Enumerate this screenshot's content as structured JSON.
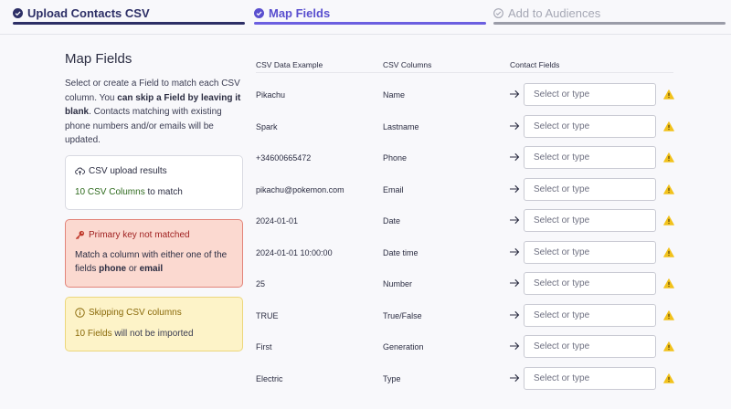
{
  "stepper": {
    "steps": [
      {
        "label": "Upload Contacts CSV",
        "state": "completed",
        "icon": "check-circle-icon"
      },
      {
        "label": "Map Fields",
        "state": "active",
        "icon": "check-circle-icon"
      },
      {
        "label": "Add to Audiences",
        "state": "pending",
        "icon": "check-circle-outline-icon"
      }
    ]
  },
  "left": {
    "title": "Map Fields",
    "desc_part1": "Select or create a Field to match each CSV column. You ",
    "desc_bold": "can skip a Field by leaving it blank",
    "desc_part2": ". Contacts matching with existing phone numbers and/or emails will be updated.",
    "results": {
      "icon": "cloud-upload-icon",
      "title": "CSV upload results",
      "count": "10 CSV Columns",
      "suffix": " to match"
    },
    "primary_key": {
      "icon": "key-icon",
      "title": "Primary key not matched",
      "text1": "Match a column with either one of the fields ",
      "bold1": "phone",
      "text2": " or ",
      "bold2": "email"
    },
    "skipping": {
      "icon": "info-circle-icon",
      "title": "Skipping CSV columns",
      "count": "10 Fields",
      "suffix": " will not be imported"
    }
  },
  "table": {
    "headers": [
      "CSV Data Example",
      "CSV Columns",
      "Contact Fields"
    ],
    "placeholder": "Select or type",
    "rows": [
      {
        "example": "Pikachu",
        "column": "Name"
      },
      {
        "example": "Spark",
        "column": "Lastname"
      },
      {
        "example": "+34600665472",
        "column": "Phone"
      },
      {
        "example": "pikachu@pokemon.com",
        "column": "Email"
      },
      {
        "example": "2024-01-01",
        "column": "Date"
      },
      {
        "example": "2024-01-01 10:00:00",
        "column": "Date time"
      },
      {
        "example": "25",
        "column": "Number"
      },
      {
        "example": "TRUE",
        "column": "True/False"
      },
      {
        "example": "First",
        "column": "Generation"
      },
      {
        "example": "Electric",
        "column": "Type"
      }
    ]
  },
  "colors": {
    "step_completed": "#2d2f66",
    "step_active": "#5a4fcf",
    "step_pending": "#a5a7b4",
    "warning": "#f2c21b",
    "error_bg": "#fbd9d0",
    "notice_bg": "#fdf3c8"
  }
}
